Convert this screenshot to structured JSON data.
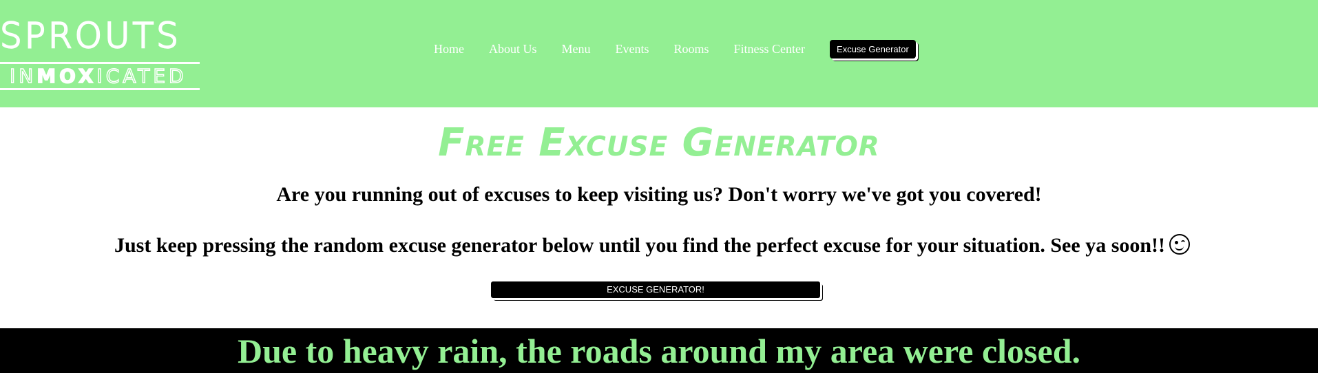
{
  "brand": {
    "logo_main": "SPROUTS",
    "logo_sub_prefix": "IN",
    "logo_sub_bold": "MOX",
    "logo_sub_suffix": "ICATED"
  },
  "nav": {
    "items": [
      "Home",
      "About Us",
      "Menu",
      "Events",
      "Rooms",
      "Fitness Center"
    ],
    "active_button": "Excuse Generator"
  },
  "main": {
    "title": "Free Excuse Generator",
    "line1": "Are you running out of excuses to keep visiting us? Don't worry we've got you covered!",
    "line2": "Just keep pressing the random excuse generator below until you find the perfect excuse for your situation. See ya soon!!",
    "emoji": "winking-face-icon",
    "generator_button": "EXCUSE GENERATOR!",
    "result": "Due to heavy rain, the roads around my area were closed."
  },
  "colors": {
    "accent_green": "#93ef93",
    "black": "#000000",
    "white": "#ffffff"
  }
}
